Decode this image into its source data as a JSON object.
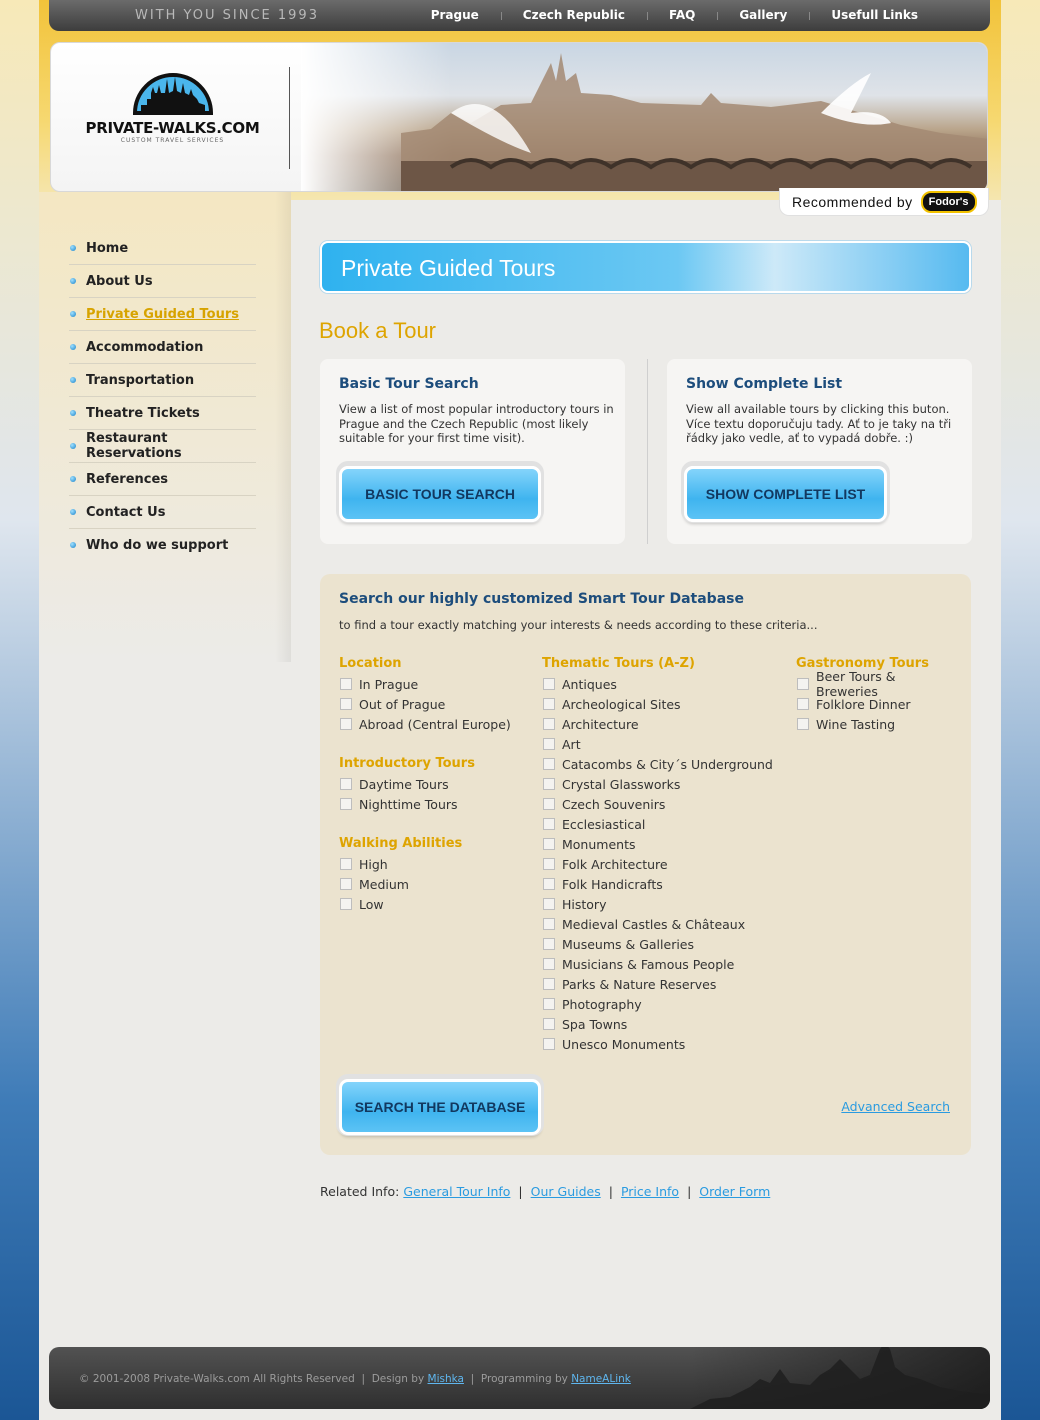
{
  "topbar": {
    "slogan": "WITH YOU SINCE 1993",
    "nav": [
      "Prague",
      "Czech Republic",
      "FAQ",
      "Gallery",
      "Usefull Links"
    ]
  },
  "header": {
    "logo_title": "PRIVATE-WALKS.COM",
    "logo_subtitle": "CUSTOM TRAVEL SERVICES",
    "recommended_label": "Recommended by",
    "recommended_brand": "Fodor's"
  },
  "sidebar": {
    "items": [
      {
        "label": "Home",
        "active": false
      },
      {
        "label": "About Us",
        "active": false
      },
      {
        "label": "Private Guided Tours",
        "active": true
      },
      {
        "label": "Accommodation",
        "active": false
      },
      {
        "label": "Transportation",
        "active": false
      },
      {
        "label": "Theatre Tickets",
        "active": false
      },
      {
        "label": "Restaurant Reservations",
        "active": false
      },
      {
        "label": "References",
        "active": false
      },
      {
        "label": "Contact Us",
        "active": false
      },
      {
        "label": "Who do we support",
        "active": false
      }
    ]
  },
  "main": {
    "page_title": "Private Guided Tours",
    "book_title": "Book a Tour",
    "basic": {
      "title": "Basic Tour Search",
      "text": "View a list of most popular introductory tours in Prague and the Czech Republic (most likely suitable for your first time visit).",
      "button": "BASIC TOUR SEARCH"
    },
    "complete": {
      "title": "Show Complete List",
      "text": "View all available tours by clicking this buton. Více textu doporučuju tady. Ať to je taky na tři řádky jako vedle, ať to vypadá dobře. :)",
      "button": "SHOW COMPLETE LIST"
    },
    "database": {
      "title": "Search our highly customized Smart Tour Database",
      "subtitle": "to find a tour exactly matching your interests & needs according to these criteria...",
      "location": {
        "title": "Location",
        "options": [
          "In Prague",
          "Out of Prague",
          "Abroad (Central Europe)"
        ]
      },
      "introductory": {
        "title": "Introductory Tours",
        "options": [
          "Daytime Tours",
          "Nighttime Tours"
        ]
      },
      "walking": {
        "title": "Walking Abilities",
        "options": [
          "High",
          "Medium",
          "Low"
        ]
      },
      "thematic": {
        "title": "Thematic Tours (A-Z)",
        "options": [
          "Antiques",
          "Archeological Sites",
          "Architecture",
          "Art",
          "Catacombs & City´s Underground",
          "Crystal Glassworks",
          "Czech Souvenirs",
          "Ecclesiastical",
          "Monuments",
          "Folk Architecture",
          "Folk Handicrafts",
          "History",
          "Medieval Castles & Châteaux",
          "Museums & Galleries",
          "Musicians & Famous People",
          "Parks & Nature Reserves",
          "Photography",
          "Spa Towns",
          "Unesco Monuments"
        ]
      },
      "gastronomy": {
        "title": "Gastronomy Tours",
        "options": [
          "Beer Tours & Breweries",
          "Folklore Dinner",
          "Wine Tasting"
        ]
      },
      "search_button": "SEARCH THE DATABASE",
      "advanced_link": "Advanced Search"
    },
    "related": {
      "label": "Related Info:",
      "links": [
        "General Tour Info",
        "Our Guides",
        "Price Info",
        "Order Form"
      ]
    }
  },
  "footer": {
    "copyright": "© 2001-2008 Private-Walks.com All Rights Reserved",
    "design_label": "Design by",
    "design_link": "Mishka",
    "programming_label": "Programming by",
    "programming_link": "NameALink"
  },
  "colors": {
    "accent_gold": "#dea400",
    "heading_blue": "#1d4d7c",
    "link_blue": "#2a9be0",
    "button_blue": "#3fb4ef"
  }
}
